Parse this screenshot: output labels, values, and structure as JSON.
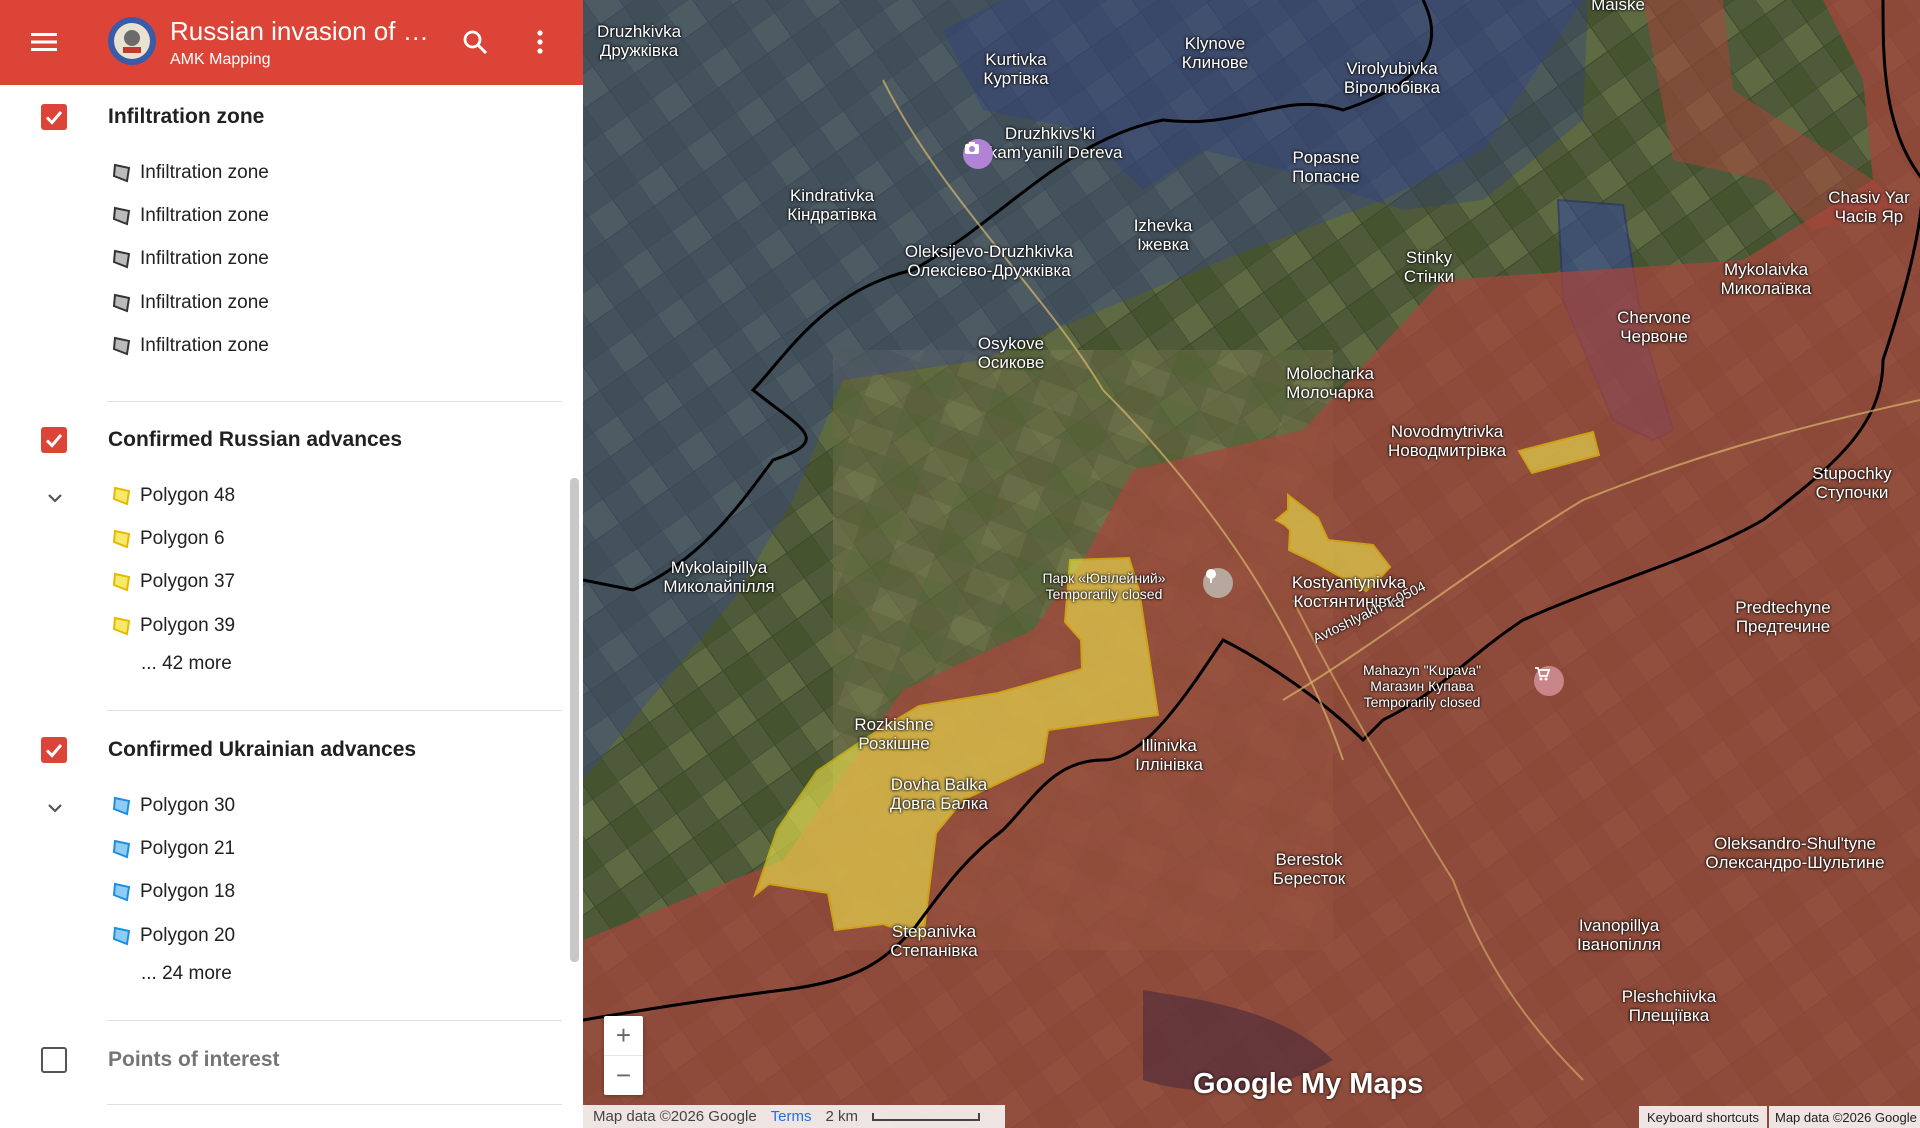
{
  "header": {
    "title": "Russian invasion of U...",
    "subtitle": "AMK Mapping"
  },
  "sections": [
    {
      "title": "Infiltration zone",
      "checked": true,
      "items": [
        "Infiltration zone",
        "Infiltration zone",
        "Infiltration zone",
        "Infiltration zone",
        "Infiltration zone"
      ],
      "icon": "gray-polygon-icon",
      "more": ""
    },
    {
      "title": "Confirmed Russian advances",
      "checked": true,
      "items": [
        "Polygon 48",
        "Polygon 6",
        "Polygon 37",
        "Polygon 39"
      ],
      "icon": "yellow-polygon-icon",
      "more": "... 42 more"
    },
    {
      "title": "Confirmed Ukrainian advances",
      "checked": true,
      "items": [
        "Polygon 30",
        "Polygon 21",
        "Polygon 18",
        "Polygon 20"
      ],
      "icon": "blue-polygon-icon",
      "more": "... 24 more"
    },
    {
      "title": "Points of interest",
      "checked": false,
      "items": [],
      "more": ""
    }
  ],
  "colors": {
    "header": "#db4437",
    "russian_zone": "#a8453c",
    "ukrainian_zone": "#3a4a8c",
    "advance_yellow": "#f2e94e",
    "front_line": "#000000"
  },
  "map": {
    "places": [
      {
        "l1": "Druzhkivka",
        "l2": "Дружківка"
      },
      {
        "l1": "Kurtivka",
        "l2": "Куртівка"
      },
      {
        "l1": "Klynove",
        "l2": "Клинове"
      },
      {
        "l1": "Virolyubivka",
        "l2": "Віролюбівка"
      },
      {
        "l1": "Maiske",
        "l2": ""
      },
      {
        "l1": "Druzhkivs'ki",
        "l2": "Skam'yanili Dereva"
      },
      {
        "l1": "Popasne",
        "l2": "Попасне"
      },
      {
        "l1": "Chasiv Yar",
        "l2": "Часів Яр"
      },
      {
        "l1": "Kindrativka",
        "l2": "Кіндратівка"
      },
      {
        "l1": "Izhevka",
        "l2": "Іжевка"
      },
      {
        "l1": "Oleksijevo-Druzhkivka",
        "l2": "Олексієво-Дружківка"
      },
      {
        "l1": "Stinky",
        "l2": "Стінки"
      },
      {
        "l1": "Mykolaivka",
        "l2": "Миколаївка"
      },
      {
        "l1": "Chervone",
        "l2": "Червоне"
      },
      {
        "l1": "Osykove",
        "l2": "Осикове"
      },
      {
        "l1": "Molocharka",
        "l2": "Молочарка"
      },
      {
        "l1": "Novodmytrivka",
        "l2": "Новодмитрівка"
      },
      {
        "l1": "Stupochky",
        "l2": "Ступочки"
      },
      {
        "l1": "Mykolaipillya",
        "l2": "Миколайпілля"
      },
      {
        "l1": "Парк «Ювілейний»",
        "l2": "Temporarily closed"
      },
      {
        "l1": "Kostyantynivka",
        "l2": "Костянтинівка"
      },
      {
        "l1": "Predtechyne",
        "l2": "Предтечине"
      },
      {
        "l1": "Mahazyn \"Kupava\"",
        "l2": "Магазин Купава"
      },
      {
        "l1": "Rozkishne",
        "l2": "Розкішне"
      },
      {
        "l1": "Dovha Balka",
        "l2": "Довга Балка"
      },
      {
        "l1": "Illinivka",
        "l2": "Іллінівка"
      },
      {
        "l1": "Oleksandro-Shul'tyne",
        "l2": "Олександро-Шультине"
      },
      {
        "l1": "Berestok",
        "l2": "Бересток"
      },
      {
        "l1": "Ivanopillya",
        "l2": "Іванопілля"
      },
      {
        "l1": "Stepanivka",
        "l2": "Степанівка"
      },
      {
        "l1": "Pleshchiivka",
        "l2": "Плещіївка"
      },
      {
        "l1": "Avtoshlyakh-T-0504",
        "l2": ""
      }
    ],
    "zoom_in": "+",
    "zoom_out": "−",
    "brand": "Google My Maps",
    "attribution": "Map data ©2026 Google",
    "terms": "Terms",
    "scale": "2 km",
    "keyboard": "Keyboard shortcuts",
    "map_data_right": "Map data ©2026 Google"
  }
}
